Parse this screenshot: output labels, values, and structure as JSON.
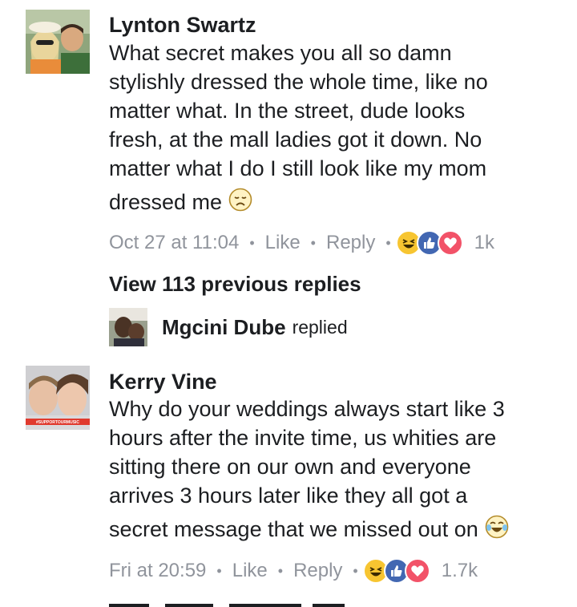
{
  "comments": [
    {
      "author": "Lynton Swartz",
      "text_lines": [
        "What secret makes you all so damn",
        "stylishly dressed the whole time, like no",
        "matter what. In the street, dude looks",
        "fresh, at the mall ladies got it down. No",
        "matter what I do I still look like my mom",
        "dressed me"
      ],
      "emoji": "disappointed-face-icon",
      "time": "Oct 27 at 11:04",
      "like_label": "Like",
      "reply_label": "Reply",
      "reactions": [
        "haha",
        "like",
        "love"
      ],
      "reaction_count": "1k"
    },
    {
      "author": "Kerry Vine",
      "text_lines": [
        "Why do your weddings always start like 3",
        "hours after the invite time, us whities are",
        "sitting there on our own and everyone",
        "arrives 3 hours later like they all got a",
        "secret message that we missed out on"
      ],
      "emoji": "tears-of-joy-icon",
      "time": "Fri at 20:59",
      "like_label": "Like",
      "reply_label": "Reply",
      "reactions": [
        "haha",
        "like",
        "love"
      ],
      "reaction_count": "1.7k"
    }
  ],
  "view_replies": "View 113 previous replies",
  "latest_reply": {
    "author": "Mgcini Dube",
    "verb": "replied"
  },
  "colors": {
    "meta_gray": "#90949c",
    "like_blue": "#4267b2",
    "love_red": "#f25268",
    "haha_yellow": "#f7c531"
  }
}
